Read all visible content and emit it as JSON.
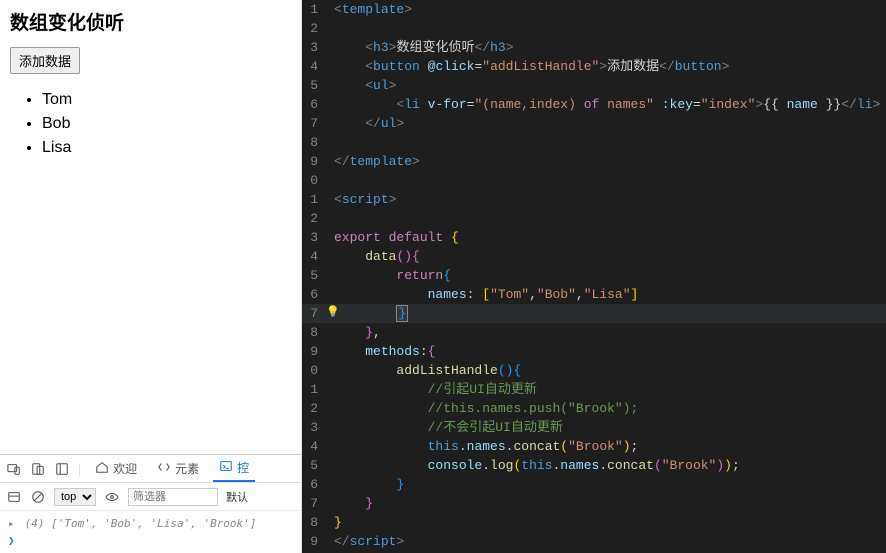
{
  "app": {
    "title": "数组变化侦听",
    "button_label": "添加数据",
    "list": [
      "Tom",
      "Bob",
      "Lisa"
    ]
  },
  "devtools": {
    "tabs": {
      "welcome": "欢迎",
      "elements": "元素",
      "console": "控"
    },
    "context": "top",
    "filter_placeholder": "筛选器",
    "levels": "默认",
    "console_output": {
      "length": "(4)",
      "items": "['Tom', 'Bob', 'Lisa', 'Brook']"
    }
  },
  "editor": {
    "lines": [
      {
        "n": "1",
        "html": "<span class='c-tag'>&lt;</span><span class='c-el'>template</span><span class='c-tag'>&gt;</span>"
      },
      {
        "n": "2",
        "html": ""
      },
      {
        "n": "3",
        "html": "    <span class='c-tag'>&lt;</span><span class='c-el'>h3</span><span class='c-tag'>&gt;</span>数组变化侦听<span class='c-tag'>&lt;/</span><span class='c-el'>h3</span><span class='c-tag'>&gt;</span>"
      },
      {
        "n": "4",
        "html": "    <span class='c-tag'>&lt;</span><span class='c-el'>button</span> <span class='c-attr'>@click</span>=<span class='c-str'>\"addListHandle\"</span><span class='c-tag'>&gt;</span>添加数据<span class='c-tag'>&lt;/</span><span class='c-el'>button</span><span class='c-tag'>&gt;</span>"
      },
      {
        "n": "5",
        "html": "    <span class='c-tag'>&lt;</span><span class='c-el'>ul</span><span class='c-tag'>&gt;</span>"
      },
      {
        "n": "6",
        "html": "        <span class='c-tag'>&lt;</span><span class='c-el'>li</span> <span class='c-attr'>v-for</span>=<span class='c-str'>\"(name,index) </span><span class='c-kw'>of</span><span class='c-str'> names\"</span> <span class='c-attr'>:key</span>=<span class='c-str'>\"index\"</span><span class='c-tag'>&gt;</span><span class='c-pun'>{{ </span><span class='c-var'>name</span><span class='c-pun'> }}</span><span class='c-tag'>&lt;/</span><span class='c-el'>li</span><span class='c-tag'>&gt;</span>"
      },
      {
        "n": "7",
        "html": "    <span class='c-tag'>&lt;/</span><span class='c-el'>ul</span><span class='c-tag'>&gt;</span>"
      },
      {
        "n": "8",
        "html": ""
      },
      {
        "n": "9",
        "html": "<span class='c-tag'>&lt;/</span><span class='c-el'>template</span><span class='c-tag'>&gt;</span>"
      },
      {
        "n": "0",
        "html": ""
      },
      {
        "n": "1",
        "html": "<span class='c-tag'>&lt;</span><span class='c-el'>script</span><span class='c-tag'>&gt;</span>"
      },
      {
        "n": "2",
        "html": ""
      },
      {
        "n": "3",
        "html": "<span class='c-kw'>export</span> <span class='c-kw'>default</span> <span class='c-br'>{</span>"
      },
      {
        "n": "4",
        "html": "    <span class='c-fn'>data</span><span class='c-br2'>()</span><span class='c-br2'>{</span>"
      },
      {
        "n": "5",
        "html": "        <span class='c-kw'>return</span><span class='c-br3'>{</span>"
      },
      {
        "n": "6",
        "html": "            <span class='c-var'>names</span>: <span class='c-br'>[</span><span class='c-str'>\"Tom\"</span>,<span class='c-str'>\"Bob\"</span>,<span class='c-str'>\"Lisa\"</span><span class='c-br'>]</span>"
      },
      {
        "n": "7",
        "html": "        <span class='cursor-box c-br3'>}</span>",
        "hl": true,
        "bulb": true
      },
      {
        "n": "8",
        "html": "    <span class='c-br2'>}</span>,"
      },
      {
        "n": "9",
        "html": "    <span class='c-var'>methods</span>:<span class='c-br2'>{</span>"
      },
      {
        "n": "0",
        "html": "        <span class='c-fn'>addListHandle</span><span class='c-br3'>()</span><span class='c-br3'>{</span>"
      },
      {
        "n": "1",
        "html": "            <span class='c-comment'>//引起UI自动更新</span>"
      },
      {
        "n": "2",
        "html": "            <span class='c-comment'>//this.names.push(\"Brook\");</span>"
      },
      {
        "n": "3",
        "html": "            <span class='c-comment'>//不会引起UI自动更新</span>"
      },
      {
        "n": "4",
        "html": "            <span class='c-kw2'>this</span>.<span class='c-var'>names</span>.<span class='c-fn'>concat</span><span class='c-br'>(</span><span class='c-str'>\"Brook\"</span><span class='c-br'>)</span>;"
      },
      {
        "n": "5",
        "html": "            <span class='c-var'>console</span>.<span class='c-fn'>log</span><span class='c-br'>(</span><span class='c-kw2'>this</span>.<span class='c-var'>names</span>.<span class='c-fn'>concat</span><span class='c-br2'>(</span><span class='c-str'>\"Brook\"</span><span class='c-br2'>)</span><span class='c-br'>)</span>;"
      },
      {
        "n": "6",
        "html": "        <span class='c-br3'>}</span>"
      },
      {
        "n": "7",
        "html": "    <span class='c-br2'>}</span>"
      },
      {
        "n": "8",
        "html": "<span class='c-br'>}</span>"
      },
      {
        "n": "9",
        "html": "<span class='c-tag'>&lt;/</span><span class='c-el'>script</span><span class='c-tag'>&gt;</span>"
      }
    ]
  }
}
